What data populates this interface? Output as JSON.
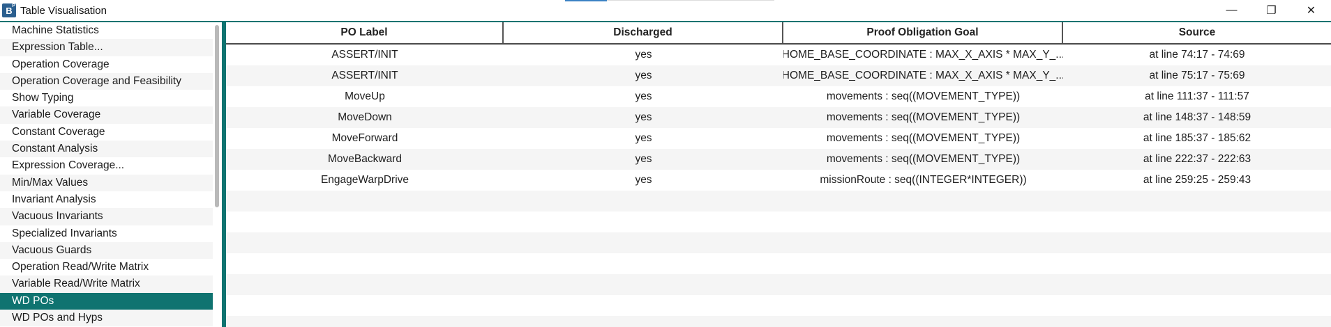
{
  "window": {
    "title": "Table Visualisation",
    "icon_letter": "B",
    "icon_sub": "P",
    "minimize": "—",
    "restore": "❐",
    "close": "✕"
  },
  "sidebar": {
    "items": [
      {
        "label": "Machine Statistics"
      },
      {
        "label": "Expression Table..."
      },
      {
        "label": "Operation Coverage"
      },
      {
        "label": "Operation Coverage and Feasibility"
      },
      {
        "label": "Show Typing"
      },
      {
        "label": "Variable Coverage"
      },
      {
        "label": "Constant Coverage"
      },
      {
        "label": "Constant Analysis"
      },
      {
        "label": "Expression Coverage..."
      },
      {
        "label": "Min/Max Values"
      },
      {
        "label": "Invariant Analysis"
      },
      {
        "label": "Vacuous Invariants"
      },
      {
        "label": "Specialized Invariants"
      },
      {
        "label": "Vacuous Guards"
      },
      {
        "label": "Operation Read/Write Matrix"
      },
      {
        "label": "Variable Read/Write Matrix"
      },
      {
        "label": "WD POs"
      },
      {
        "label": "WD POs and Hyps"
      }
    ],
    "selected": "WD POs"
  },
  "table": {
    "columns": [
      "PO Label",
      "Discharged",
      "Proof Obligation Goal",
      "Source"
    ],
    "rows": [
      [
        "ASSERT/INIT",
        "yes",
        "HOME_BASE_COORDINATE : MAX_X_AXIS * MAX_Y_...",
        "at line 74:17 - 74:69"
      ],
      [
        "ASSERT/INIT",
        "yes",
        "HOME_BASE_COORDINATE : MAX_X_AXIS * MAX_Y_...",
        "at line 75:17 - 75:69"
      ],
      [
        "MoveUp",
        "yes",
        "movements : seq((MOVEMENT_TYPE))",
        "at line 111:37 - 111:57"
      ],
      [
        "MoveDown",
        "yes",
        "movements : seq((MOVEMENT_TYPE))",
        "at line 148:37 - 148:59"
      ],
      [
        "MoveForward",
        "yes",
        "movements : seq((MOVEMENT_TYPE))",
        "at line 185:37 - 185:62"
      ],
      [
        "MoveBackward",
        "yes",
        "movements : seq((MOVEMENT_TYPE))",
        "at line 222:37 - 222:63"
      ],
      [
        "EngageWarpDrive",
        "yes",
        "missionRoute : seq((INTEGER*INTEGER))",
        "at line 259:25 - 259:43"
      ]
    ],
    "empty_rows": 7
  },
  "colors": {
    "accent": "#0f7370",
    "row_alt": "#f5f5f5"
  }
}
